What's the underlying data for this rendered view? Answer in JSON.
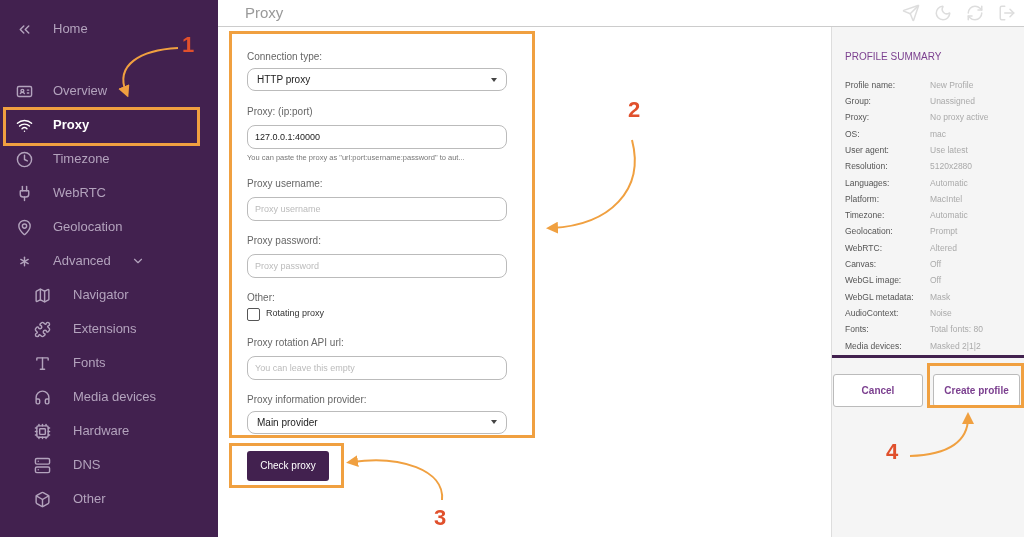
{
  "sidebar": {
    "back": {
      "label": "Home"
    },
    "items": [
      {
        "label": "Overview",
        "selected": false
      },
      {
        "label": "Proxy",
        "selected": true
      },
      {
        "label": "Timezone",
        "selected": false
      },
      {
        "label": "WebRTC",
        "selected": false
      },
      {
        "label": "Geolocation",
        "selected": false
      },
      {
        "label": "Advanced",
        "selected": false,
        "expanded": true,
        "children": [
          {
            "label": "Navigator",
            "selected": false
          },
          {
            "label": "Extensions",
            "selected": false
          },
          {
            "label": "Fonts",
            "selected": false
          },
          {
            "label": "Media devices",
            "selected": false
          },
          {
            "label": "Hardware",
            "selected": false
          },
          {
            "label": "DNS",
            "selected": false
          },
          {
            "label": "Other",
            "selected": false
          }
        ]
      }
    ]
  },
  "header": {
    "title": "Proxy"
  },
  "form": {
    "fields": [
      {
        "kind": "select",
        "label": "Connection type:",
        "value": "HTTP proxy"
      },
      {
        "kind": "input",
        "label": "Proxy: (ip:port)",
        "value": "127.0.0.1:40000",
        "hint": "You can paste the proxy as \"url:port:username:password\" to aut..."
      },
      {
        "kind": "input",
        "label": "Proxy username:",
        "placeholder": "Proxy username"
      },
      {
        "kind": "input",
        "label": "Proxy password:",
        "placeholder": "Proxy password"
      },
      {
        "kind": "checkbox",
        "label": "Other:",
        "option": "Rotating proxy",
        "checked": false
      },
      {
        "kind": "input",
        "label": "Proxy rotation API url:",
        "placeholder": "You can leave this empty"
      },
      {
        "kind": "select",
        "label": "Proxy information provider:",
        "value": "Main provider"
      }
    ],
    "button": "Check proxy"
  },
  "summary": {
    "title": "PROFILE SUMMARY",
    "rows": [
      {
        "label": "Profile name:",
        "value": "New Profile"
      },
      {
        "label": "Group:",
        "value": "Unassigned"
      },
      {
        "label": "Proxy:",
        "value": "No proxy active"
      },
      {
        "label": "OS:",
        "value": "mac"
      },
      {
        "label": "User agent:",
        "value": "Use latest"
      },
      {
        "label": "Resolution:",
        "value": "5120x2880"
      },
      {
        "label": "Languages:",
        "value": "Automatic"
      },
      {
        "label": "Platform:",
        "value": "MacIntel"
      },
      {
        "label": "Timezone:",
        "value": "Automatic"
      },
      {
        "label": "Geolocation:",
        "value": "Prompt"
      },
      {
        "label": "WebRTC:",
        "value": "Altered"
      },
      {
        "label": "Canvas:",
        "value": "Off"
      },
      {
        "label": "WebGL image:",
        "value": "Off"
      },
      {
        "label": "WebGL metadata:",
        "value": "Mask"
      },
      {
        "label": "AudioContext:",
        "value": "Noise"
      },
      {
        "label": "Fonts:",
        "value": "Total fonts: 80"
      },
      {
        "label": "Media devices:",
        "value": "Masked 2|1|2"
      }
    ],
    "buttons": [
      {
        "kind": "cancel",
        "label": "Cancel"
      },
      {
        "kind": "create",
        "label": "Create profile"
      }
    ]
  },
  "annotations": [
    "1",
    "2",
    "3",
    "4"
  ]
}
